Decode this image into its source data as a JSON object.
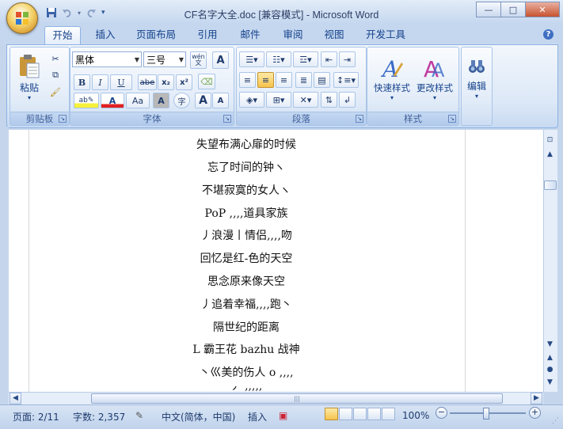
{
  "window": {
    "title": "CF名字大全.doc [兼容模式] - Microsoft Word",
    "minimize_label": "—",
    "maximize_label": "□",
    "close_label": "✕"
  },
  "qat": {
    "save_icon": "save-icon",
    "undo_icon": "undo-icon",
    "redo_icon": "redo-icon",
    "customize_icon": "customize-qat-icon"
  },
  "tabs": [
    {
      "label": "开始",
      "active": true
    },
    {
      "label": "插入"
    },
    {
      "label": "页面布局"
    },
    {
      "label": "引用"
    },
    {
      "label": "邮件"
    },
    {
      "label": "审阅"
    },
    {
      "label": "视图"
    },
    {
      "label": "开发工具"
    }
  ],
  "help_label": "?",
  "ribbon": {
    "clipboard": {
      "group_label": "剪贴板",
      "paste_label": "粘贴"
    },
    "font": {
      "group_label": "字体",
      "font_name": "黑体",
      "font_size": "三号",
      "wen_label": "wén\n文",
      "A_label": "A",
      "bold": "B",
      "italic": "I",
      "underline": "U",
      "strike": "abe",
      "subscript": "x₂",
      "superscript": "x²",
      "case_label": "Aa",
      "char_shade": "A",
      "enclose": "字",
      "grow": "A",
      "shrink": "A"
    },
    "paragraph": {
      "group_label": "段落"
    },
    "styles": {
      "group_label": "样式",
      "quick_styles_label": "快速样式",
      "change_styles_label": "更改样式"
    },
    "editing": {
      "label": "编辑"
    }
  },
  "document": {
    "lines": [
      "失望布满心扉的时候",
      "忘了时间的钟ヽ",
      "不堪寂寞的女人ヽ",
      "PoP ,,,,道具家族",
      "丿浪漫丨情侣,,,,吻",
      "回忆是红-色的天空",
      "思念原来像天空",
      "丿追着幸福,,,,跑丶",
      "隔世纪的距离",
      "L 霸王花 bazhu 战神",
      "丶巛美的伤人 o ,,,,",
      "丿  ,,,,,"
    ]
  },
  "status": {
    "page": "页面: 2/11",
    "words": "字数: 2,357",
    "language": "中文(简体，中国)",
    "insert_mode": "插入",
    "zoom": "100%"
  }
}
